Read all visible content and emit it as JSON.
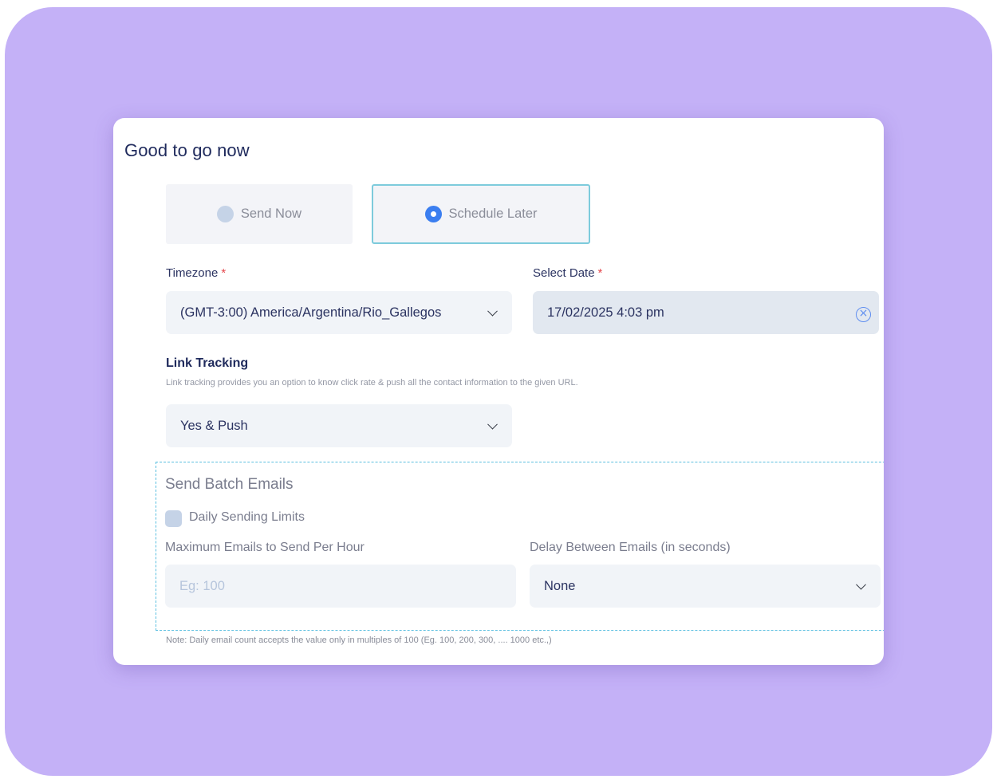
{
  "card": {
    "title": "Good to go now"
  },
  "send_options": [
    {
      "label": "Send Now",
      "selected": false
    },
    {
      "label": "Schedule Later",
      "selected": true
    }
  ],
  "timezone": {
    "label": "Timezone",
    "required_mark": "*",
    "value": "(GMT-3:00) America/Argentina/Rio_Gallegos",
    "icon": "chevron-down-icon"
  },
  "select_date": {
    "label": "Select Date",
    "required_mark": "*",
    "value": "17/02/2025 4:03 pm",
    "clear_icon": "clear-circle-icon",
    "clear_glyph": "×"
  },
  "link_tracking": {
    "heading": "Link Tracking",
    "description": "Link tracking provides you an option to know click rate & push all the contact information to the given URL.",
    "value": "Yes & Push",
    "icon": "chevron-down-icon"
  },
  "batch": {
    "title": "Send Batch Emails",
    "daily_limits_label": "Daily Sending Limits",
    "daily_limits_checked": false,
    "max_per_hour": {
      "label": "Maximum Emails to Send Per Hour",
      "value": "",
      "placeholder": "Eg: 100"
    },
    "delay": {
      "label": "Delay Between Emails (in seconds)",
      "value": "None",
      "icon": "chevron-down-icon"
    },
    "note": "Note: Daily email count accepts the value only in multiples of 100 (Eg. 100, 200, 300, .... 1000 etc.,)"
  },
  "colors": {
    "backdrop": "#c4b1f7",
    "title_text": "#1f2a5c",
    "radio_selected": "#3b7ef0",
    "selected_border": "#7dcbdc",
    "required": "#e5484d",
    "dashed_border": "#5bbfe0"
  }
}
